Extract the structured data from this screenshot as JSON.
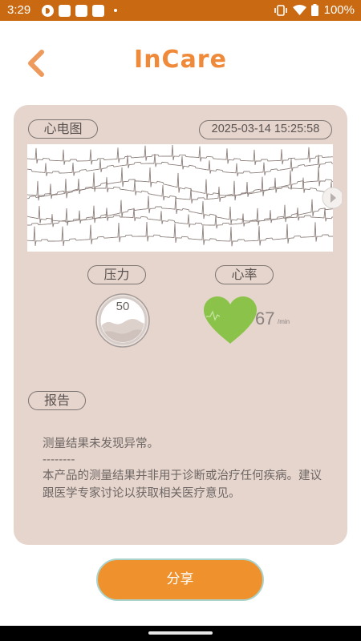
{
  "status_bar": {
    "time": "3:29",
    "battery": "100%"
  },
  "header": {
    "title": "InCare"
  },
  "ecg": {
    "label": "心电图",
    "timestamp": "2025-03-14 15:25:58"
  },
  "pressure": {
    "label": "压力",
    "value": "50"
  },
  "heart_rate": {
    "label": "心率",
    "value": "67",
    "unit": "/min"
  },
  "report": {
    "label": "报告",
    "line1": "测量结果未发现异常。",
    "divider": "--------",
    "disclaimer": "本产品的测量结果并非用于诊断或治疗任何疾病。建议跟医学专家讨论以获取相关医疗意见。"
  },
  "actions": {
    "share_label": "分享"
  },
  "colors": {
    "status_bar": "#c96a12",
    "brand_orange": "#ee8a3a",
    "card_bg": "#e6d5cd",
    "heart_green": "#8bc34a",
    "share_button": "#ef922e"
  }
}
